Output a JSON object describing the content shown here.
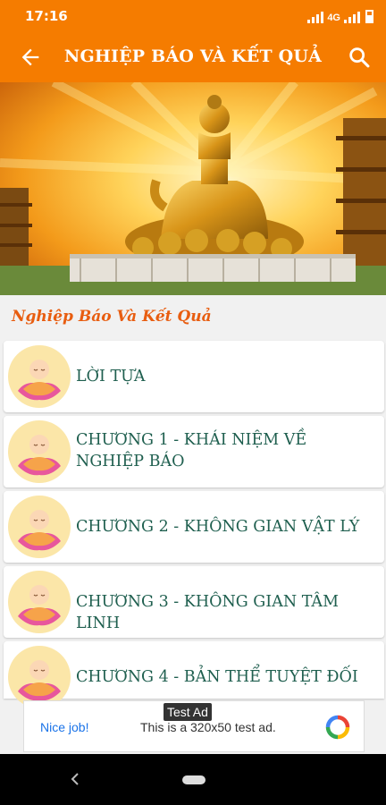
{
  "status_bar": {
    "time": "17:16",
    "network": "4G"
  },
  "app_bar": {
    "title": "NGHIỆP BÁO VÀ KẾT QUẢ"
  },
  "section": {
    "title": "Nghiệp Báo Và Kết Quả"
  },
  "chapters": [
    {
      "label": "LỜI TỰA"
    },
    {
      "label": "CHƯƠNG 1 - KHÁI NIỆM VỀ NGHIỆP BÁO"
    },
    {
      "label": "CHƯƠNG 2 - KHÔNG GIAN VẬT LÝ"
    },
    {
      "label": "CHƯƠNG 3 - KHÔNG GIAN TÂM LINH"
    },
    {
      "label": "CHƯƠNG 4 - BẢN THỂ TUYỆT ĐỐI"
    }
  ],
  "ad": {
    "tag": "Test Ad",
    "nice": "Nice job!",
    "message": "This is a 320x50 test ad."
  },
  "colors": {
    "accent": "#f57c00",
    "section_title": "#e85d10",
    "item_text": "#1f5f4f"
  },
  "icons": [
    "arrow-back-icon",
    "search-icon",
    "monk-avatar-icon",
    "ad-choices-logo-icon"
  ]
}
